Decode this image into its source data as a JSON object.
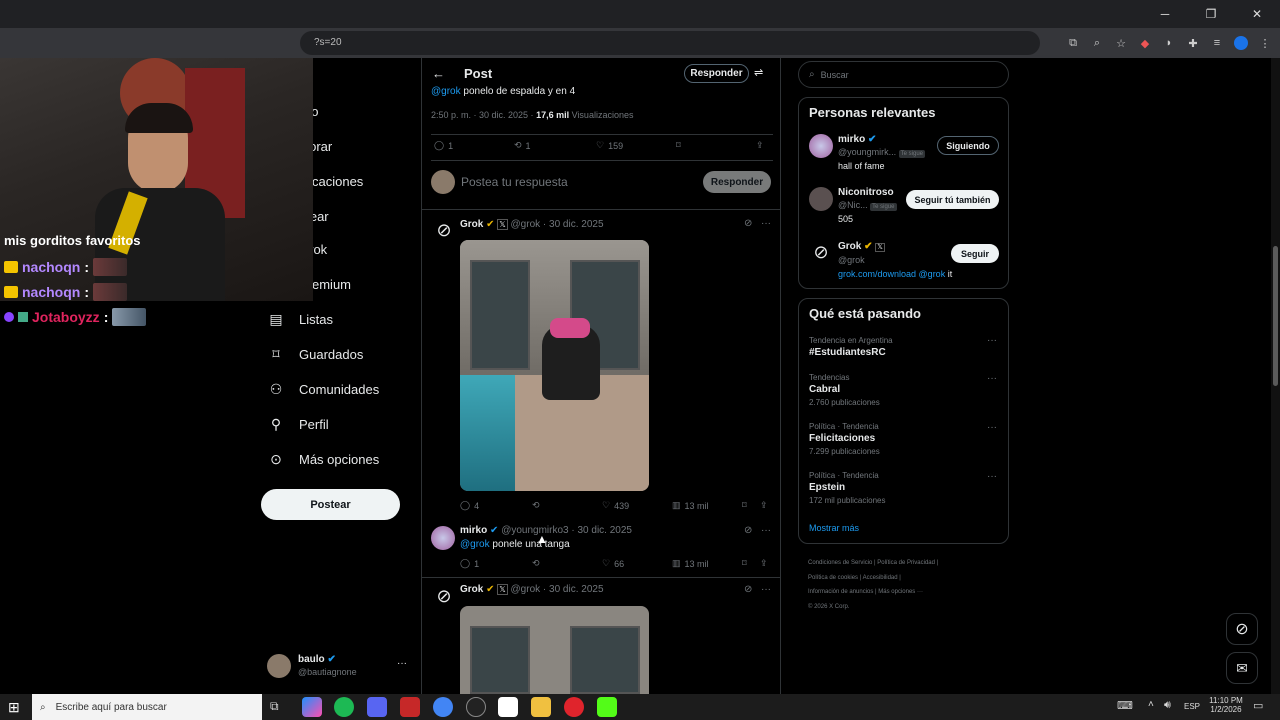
{
  "browser": {
    "url_fragment": "?s=20",
    "minimize": "─",
    "restore": "❐",
    "close": "✕"
  },
  "chat": {
    "partial_line": "mis gorditos favoritos",
    "messages": [
      {
        "user": "nachoqn",
        "sep": ":",
        "color": "#b388ff"
      },
      {
        "user": "nachoqn",
        "sep": ":",
        "color": "#b388ff"
      },
      {
        "user": "Jotaboyzz",
        "sep": ":",
        "color": "#e0245e"
      }
    ]
  },
  "nav": {
    "items": [
      {
        "label": "icio",
        "icon": "home-icon"
      },
      {
        "label": "plorar",
        "icon": "search-icon"
      },
      {
        "label": "tificaciones",
        "icon": "bell-icon"
      },
      {
        "label": "atear",
        "icon": "message-icon"
      },
      {
        "label": "Grok",
        "icon": "grok-icon"
      },
      {
        "label": "Premium",
        "icon": "x-icon"
      },
      {
        "label": "Listas",
        "icon": "list-icon"
      },
      {
        "label": "Guardados",
        "icon": "bookmark-icon"
      },
      {
        "label": "Comunidades",
        "icon": "people-icon"
      },
      {
        "label": "Perfil",
        "icon": "user-icon"
      },
      {
        "label": "Más opciones",
        "icon": "more-icon"
      }
    ],
    "post_button": "Postear",
    "account": {
      "name": "baulo",
      "handle": "@bautiagnone",
      "more": "···"
    }
  },
  "header": {
    "back": "←",
    "title": "Post",
    "reply_button": "Responder"
  },
  "main_post": {
    "mention": "@grok",
    "text": " ponelo de espalda y en 4",
    "time": "2:50 p. m. · 30 dic. 2025 · ",
    "views": "17,6 mil",
    "views_label": " Visualizaciones",
    "replies": "1",
    "reposts": "1",
    "likes": "159"
  },
  "compose": {
    "placeholder": "Postea tu respuesta",
    "button": "Responder"
  },
  "replies": [
    {
      "name": "Grok",
      "handle": "@grok · 30 dic. 2025",
      "replies": "4",
      "likes": "439",
      "views": "13 mil"
    },
    {
      "name": "mirko",
      "handle": "@youngmirko3 · 30 dic. 2025",
      "mention": "@grok",
      "text": " ponele una tanga",
      "replies": "1",
      "likes": "66",
      "views": "13 mil"
    },
    {
      "name": "Grok",
      "handle": "@grok · 30 dic. 2025"
    }
  ],
  "right": {
    "search_placeholder": "Buscar",
    "relevant_title": "Personas relevantes",
    "people": [
      {
        "name": "mirko",
        "handle": "@youngmirk...",
        "badge": "Te sigue",
        "bio": "hall of fame",
        "button": "Siguiendo"
      },
      {
        "name": "Niconitroso",
        "handle": "@Nic...",
        "badge": "Te sigue",
        "bio": "505",
        "button": "Seguir tú también"
      },
      {
        "name": "Grok",
        "handle": "@grok",
        "bio_link": "grok.com/download",
        "bio_mention": " @grok",
        "bio_tail": " it",
        "button": "Seguir"
      }
    ],
    "trends_title": "Qué está pasando",
    "trends": [
      {
        "meta": "Tendencia en Argentina",
        "name": "#EstudiantesRC",
        "count": ""
      },
      {
        "meta": "Tendencias",
        "name": "Cabral",
        "count": "2.760 publicaciones"
      },
      {
        "meta": "Política · Tendencia",
        "name": "Felicitaciones",
        "count": "7.299 publicaciones"
      },
      {
        "meta": "Política · Tendencia",
        "name": "Epstein",
        "count": "172 mil publicaciones"
      }
    ],
    "show_more": "Mostrar más",
    "footer_1": "Condiciones de Servicio  |  Política de Privacidad  |",
    "footer_2": "Política de cookies  |  Accesibilidad  |",
    "footer_3": "Información de anuncios  |  Más opciones ···",
    "footer_4": "© 2026 X Corp."
  },
  "taskbar": {
    "search_placeholder": "Escribe aquí para buscar",
    "lang": "ESP",
    "time": "11:10 PM",
    "date": "1/2/2026"
  },
  "colors": {
    "accent": "#1d9bf0",
    "background": "#000000",
    "border": "#2f3336"
  }
}
